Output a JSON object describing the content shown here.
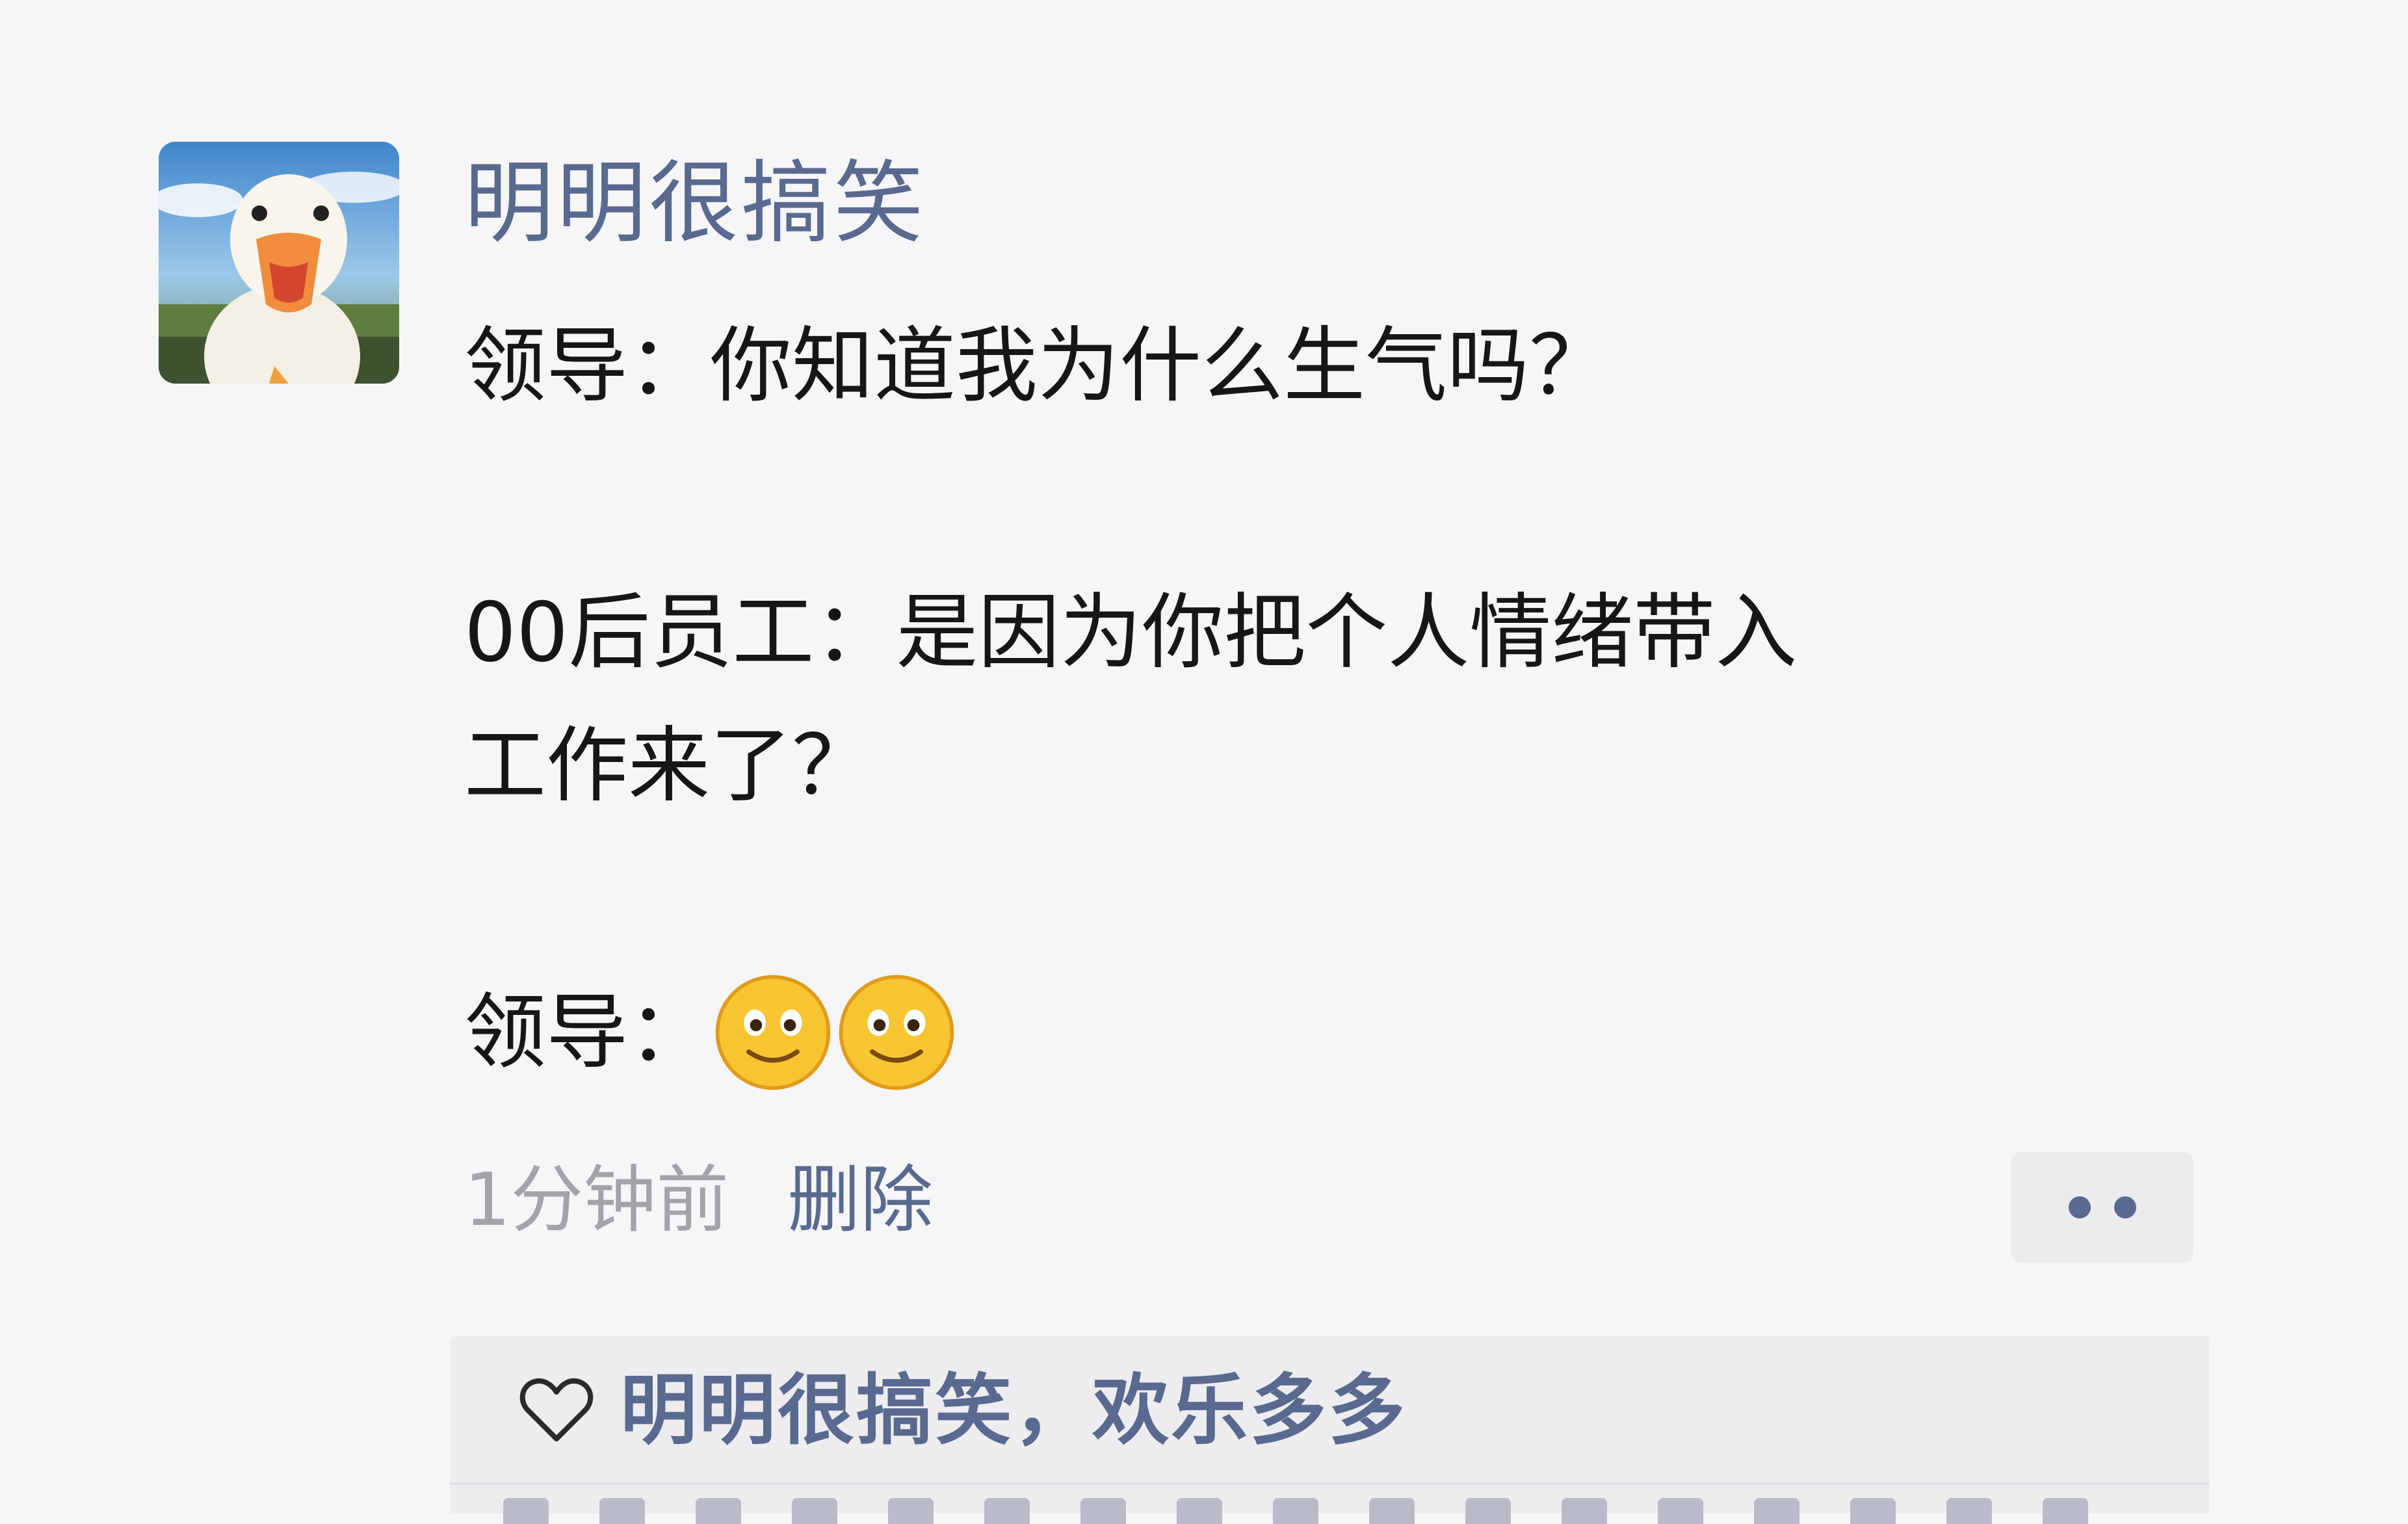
{
  "post": {
    "author": "明明很搞笑",
    "lines": [
      "领导：你知道我为什么生气吗？",
      "00后员工：是因为你把个人情绪带入",
      "工作来了？",
      "领导："
    ],
    "emoji_names": [
      "smile-emoji",
      "smile-emoji"
    ],
    "time": "1分钟前",
    "delete_label": "删除",
    "more_icon": "more-dots-icon"
  },
  "likes": {
    "icon": "heart-icon",
    "text": "明明很搞笑，欢乐多多"
  },
  "colors": {
    "author_link": "#59698f",
    "content_text": "#161616",
    "meta_text": "#a4a4a8",
    "background": "#f6f6f8",
    "likes_background": "#ededf0"
  }
}
